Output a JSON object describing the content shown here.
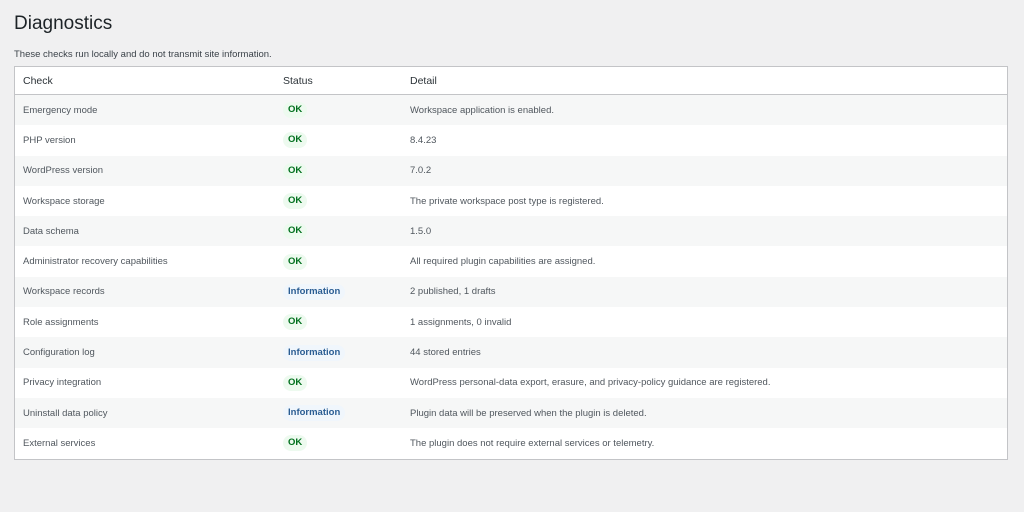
{
  "page": {
    "title": "Diagnostics",
    "description": "These checks run locally and do not transmit site information."
  },
  "table": {
    "headers": {
      "check": "Check",
      "status": "Status",
      "detail": "Detail"
    },
    "rows": [
      {
        "check": "Emergency mode",
        "status": "OK",
        "status_type": "ok",
        "detail": "Workspace application is enabled."
      },
      {
        "check": "PHP version",
        "status": "OK",
        "status_type": "ok",
        "detail": "8.4.23"
      },
      {
        "check": "WordPress version",
        "status": "OK",
        "status_type": "ok",
        "detail": "7.0.2"
      },
      {
        "check": "Workspace storage",
        "status": "OK",
        "status_type": "ok",
        "detail": "The private workspace post type is registered."
      },
      {
        "check": "Data schema",
        "status": "OK",
        "status_type": "ok",
        "detail": "1.5.0"
      },
      {
        "check": "Administrator recovery capabilities",
        "status": "OK",
        "status_type": "ok",
        "detail": "All required plugin capabilities are assigned."
      },
      {
        "check": "Workspace records",
        "status": "Information",
        "status_type": "info",
        "detail": "2 published, 1 drafts"
      },
      {
        "check": "Role assignments",
        "status": "OK",
        "status_type": "ok",
        "detail": "1 assignments, 0 invalid"
      },
      {
        "check": "Configuration log",
        "status": "Information",
        "status_type": "info",
        "detail": "44 stored entries"
      },
      {
        "check": "Privacy integration",
        "status": "OK",
        "status_type": "ok",
        "detail": "WordPress personal-data export, erasure, and privacy-policy guidance are registered."
      },
      {
        "check": "Uninstall data policy",
        "status": "Information",
        "status_type": "info",
        "detail": "Plugin data will be preserved when the plugin is deleted."
      },
      {
        "check": "External services",
        "status": "OK",
        "status_type": "ok",
        "detail": "The plugin does not require external services or telemetry."
      }
    ]
  },
  "colors": {
    "ok_text": "#00701d",
    "ok_bg": "#edfaef",
    "info_text": "#2a5d93",
    "info_bg": "#f0f6fc"
  }
}
